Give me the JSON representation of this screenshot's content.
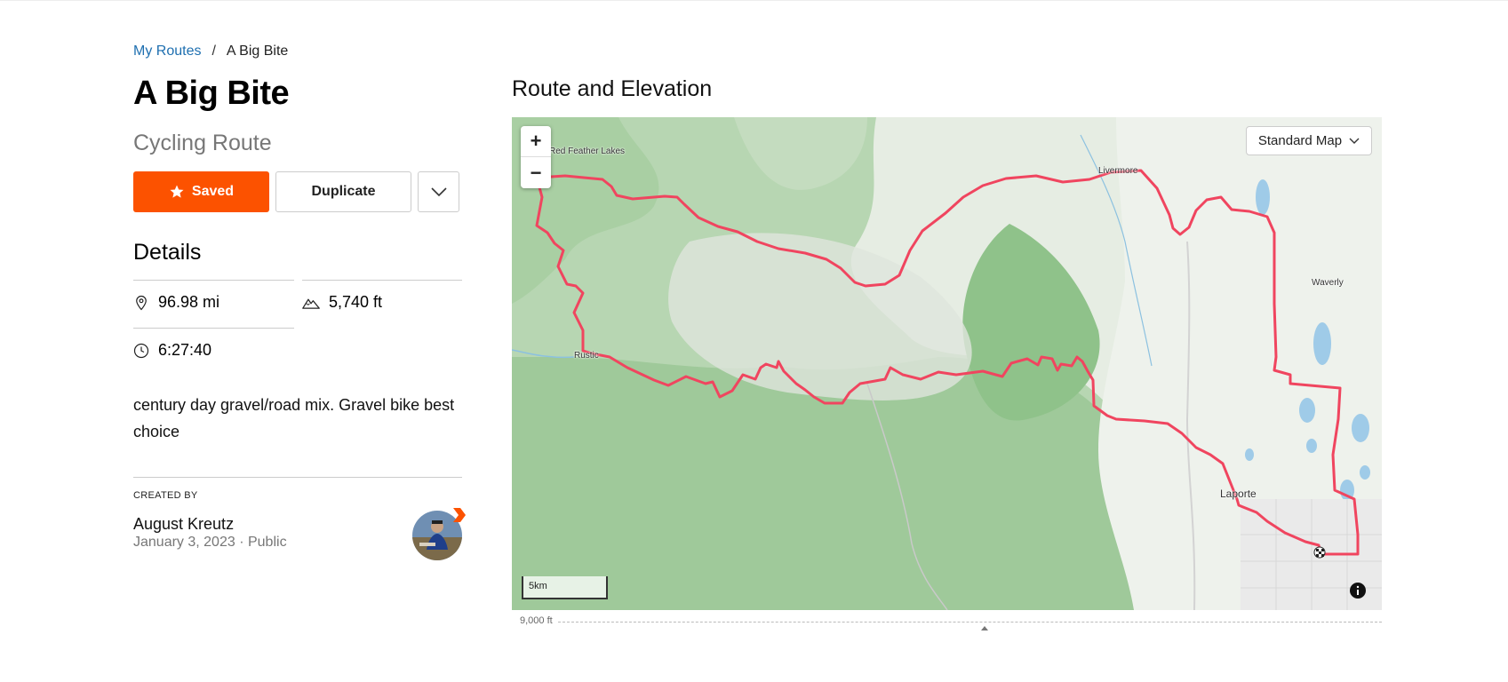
{
  "breadcrumb": {
    "parent": "My Routes",
    "separator": "/",
    "current": "A Big Bite"
  },
  "route": {
    "title": "A Big Bite",
    "type": "Cycling Route"
  },
  "actions": {
    "saved_label": "Saved",
    "duplicate_label": "Duplicate",
    "more_icon": "chevron-down-icon"
  },
  "details": {
    "title": "Details",
    "distance": "96.98 mi",
    "elevation_gain": "5,740 ft",
    "moving_time": "6:27:40",
    "description": "century day gravel/road mix. Gravel bike best choice"
  },
  "creator": {
    "label": "CREATED BY",
    "name": "August Kreutz",
    "date": "January 3, 2023",
    "visibility": "Public"
  },
  "map": {
    "section_title": "Route and Elevation",
    "style_selector": "Standard Map",
    "zoom_in": "+",
    "zoom_out": "−",
    "scale_label": "5km",
    "places": {
      "red_feather_lakes": "Red Feather Lakes",
      "livermore": "Livermore",
      "waverly": "Waverly",
      "rustic": "Rustic",
      "laporte": "Laporte"
    },
    "route_color": "#f0455f"
  },
  "elevation": {
    "axis_label": "9,000 ft"
  },
  "colors": {
    "brand": "#fc5200",
    "link": "#1e6fb0"
  }
}
